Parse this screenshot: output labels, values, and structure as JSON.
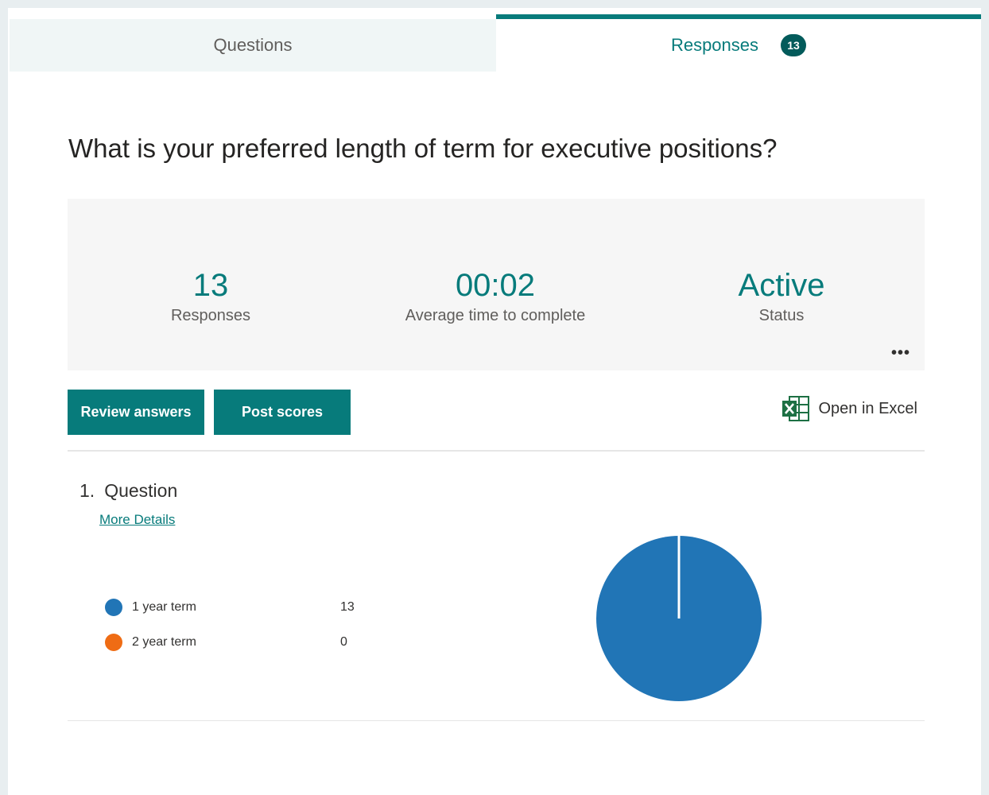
{
  "tabs": {
    "questions_label": "Questions",
    "responses_label": "Responses",
    "responses_badge": "13"
  },
  "form_title": "What is your preferred length of term for executive positions?",
  "stats": {
    "responses_value": "13",
    "responses_label": "Responses",
    "avg_time_value": "00:02",
    "avg_time_label": "Average time to complete",
    "status_value": "Active",
    "status_label": "Status",
    "more_label": "•••"
  },
  "actions": {
    "review_label": "Review answers",
    "post_label": "Post scores",
    "excel_label": "Open in Excel"
  },
  "question": {
    "number": "1.",
    "title": "Question",
    "details_link": "More Details",
    "options": [
      {
        "label": "1 year term",
        "count": "13",
        "color": "#2175b6"
      },
      {
        "label": "2 year term",
        "count": "0",
        "color": "#ef6c14"
      }
    ]
  },
  "chart_data": {
    "type": "pie",
    "categories": [
      "1 year term",
      "2 year term"
    ],
    "values": [
      13,
      0
    ],
    "colors": [
      "#2175b6",
      "#ef6c14"
    ]
  },
  "colors": {
    "accent": "#077b7b",
    "badge": "#035b5b",
    "excel_green": "#1d7044"
  },
  "icons": {
    "excel": "excel-icon"
  }
}
